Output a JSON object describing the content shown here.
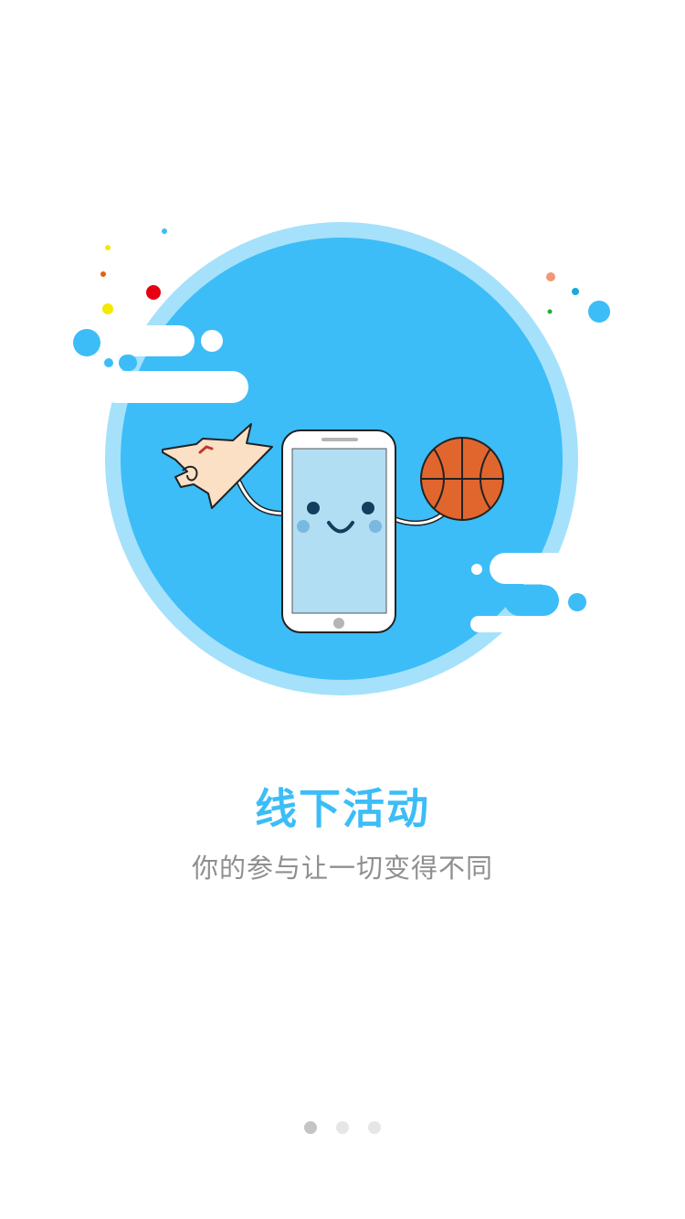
{
  "onboarding": {
    "title": "线下活动",
    "subtitle": "你的参与让一切变得不同",
    "pager": {
      "total_pages": 3,
      "current_page": 1
    }
  },
  "colors": {
    "accent": "#3cbdf7",
    "circle_outer": "#a5e1fb",
    "subtitle_text": "#8f8f8f",
    "dot_active": "#c4c4c4",
    "dot_inactive": "#e6e6e6",
    "phone_screen": "#b1def3",
    "basketball": "#e0662e"
  },
  "illustration": {
    "icons": [
      "phone-mascot-icon",
      "basketball-icon",
      "wolf-head-icon",
      "cloud-icon"
    ]
  }
}
